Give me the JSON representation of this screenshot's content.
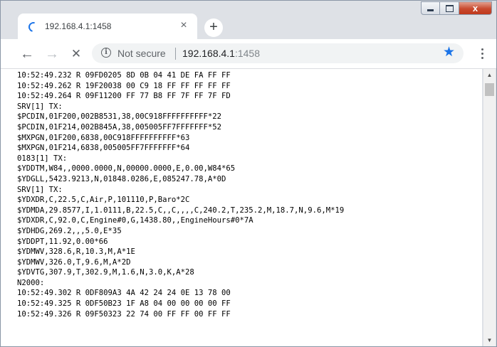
{
  "tab": {
    "title": "192.168.4.1:1458",
    "close": "×"
  },
  "new_tab": "+",
  "window_controls": {
    "close": "x"
  },
  "toolbar": {
    "back": "←",
    "forward": "→",
    "stop": "✕",
    "menu": "⋮"
  },
  "omnibox": {
    "info": "i",
    "security_text": "Not secure",
    "url_host": "192.168.4.1",
    "url_port": ":1458",
    "star": "★"
  },
  "icons": [
    "loading-spinner-icon",
    "close-icon",
    "plus-icon",
    "back-arrow-icon",
    "forward-arrow-icon",
    "stop-icon",
    "info-icon",
    "star-icon",
    "menu-icon"
  ],
  "colors": {
    "accent": "#1a73e8",
    "window_close": "#c84a2f"
  },
  "content": {
    "lines": [
      "10:52:49.232 R 09FD0205 8D 0B 04 41 DE FA FF FF",
      "10:52:49.262 R 19F20038 00 C9 18 FF FF FF FF FF",
      "10:52:49.264 R 09F11200 FF 77 B8 FF 7F FF 7F FD",
      "SRV[1] TX:",
      "$PCDIN,01F200,002B8531,38,00C918FFFFFFFFFF*22",
      "$PCDIN,01F214,002B845A,38,005005FF7FFFFFFF*52",
      "$MXPGN,01F200,6838,00C918FFFFFFFFFF*63",
      "$MXPGN,01F214,6838,005005FF7FFFFFFF*64",
      "0183[1] TX:",
      "$YDDTM,W84,,0000.0000,N,00000.0000,E,0.00,W84*65",
      "$YDGLL,5423.9213,N,01848.0286,E,085247.78,A*0D",
      "SRV[1] TX:",
      "$YDXDR,C,22.5,C,Air,P,101110,P,Baro*2C",
      "$YDMDA,29.8577,I,1.0111,B,22.5,C,,C,,,,C,240.2,T,235.2,M,18.7,N,9.6,M*19",
      "$YDXDR,C,92.0,C,Engine#0,G,1438.80,,EngineHours#0*7A",
      "$YDHDG,269.2,,,5.0,E*35",
      "$YDDPT,11.92,0.00*66",
      "$YDMWV,328.6,R,10.3,M,A*1E",
      "$YDMWV,326.0,T,9.6,M,A*2D",
      "$YDVTG,307.9,T,302.9,M,1.6,N,3.0,K,A*28",
      "N2000:",
      "10:52:49.302 R 0DF809A3 4A 42 24 24 0E 13 78 00",
      "10:52:49.325 R 0DF50B23 1F A8 04 00 00 00 00 FF",
      "10:52:49.326 R 09F50323 22 74 00 FF FF 00 FF FF"
    ]
  }
}
